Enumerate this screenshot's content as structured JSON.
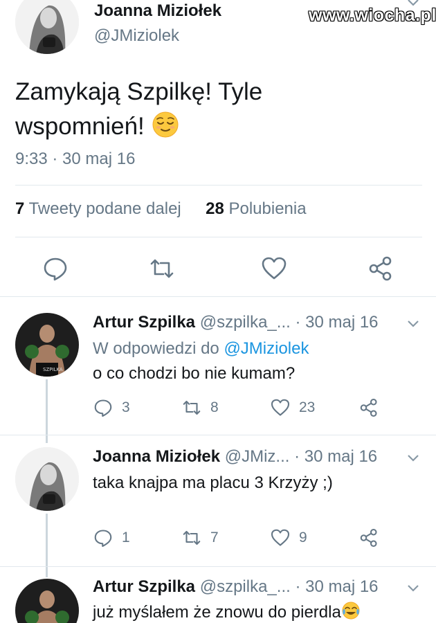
{
  "watermark": "www.wiocha.pl",
  "main_tweet": {
    "author_name": "Joanna Miziołek",
    "author_handle": "@JMiziolek",
    "text_line1": "Zamykają Szpilkę! Tyle",
    "text_line2": "wspomnień!",
    "emoji": "relieved-face",
    "timestamp": "9:33 · 30 maj 16",
    "retweets_count": "7",
    "retweets_label": "Tweety podane dalej",
    "likes_count": "28",
    "likes_label": "Polubienia"
  },
  "replies": [
    {
      "author_name": "Artur Szpilka",
      "author_handle": "@szpilka_...",
      "date": "· 30 maj 16",
      "reply_to_label": "W odpowiedzi do",
      "reply_to_handle": "@JMiziolek",
      "text": "o co chodzi bo nie kumam?",
      "replies": "3",
      "retweets": "8",
      "likes": "23"
    },
    {
      "author_name": "Joanna Miziołek",
      "author_handle": "@JMiz...",
      "date": "· 30 maj 16",
      "text": "taka knajpa ma placu 3 Krzyży ;)",
      "replies": "1",
      "retweets": "7",
      "likes": "9"
    },
    {
      "author_name": "Artur Szpilka",
      "author_handle": "@szpilka_...",
      "date": "· 30 maj 16",
      "text": "już myślałem że znowu do pierdla"
    }
  ],
  "colors": {
    "text": "#14171a",
    "secondary": "#657786",
    "link": "#1b95e0",
    "divider": "#e1e8ed"
  }
}
